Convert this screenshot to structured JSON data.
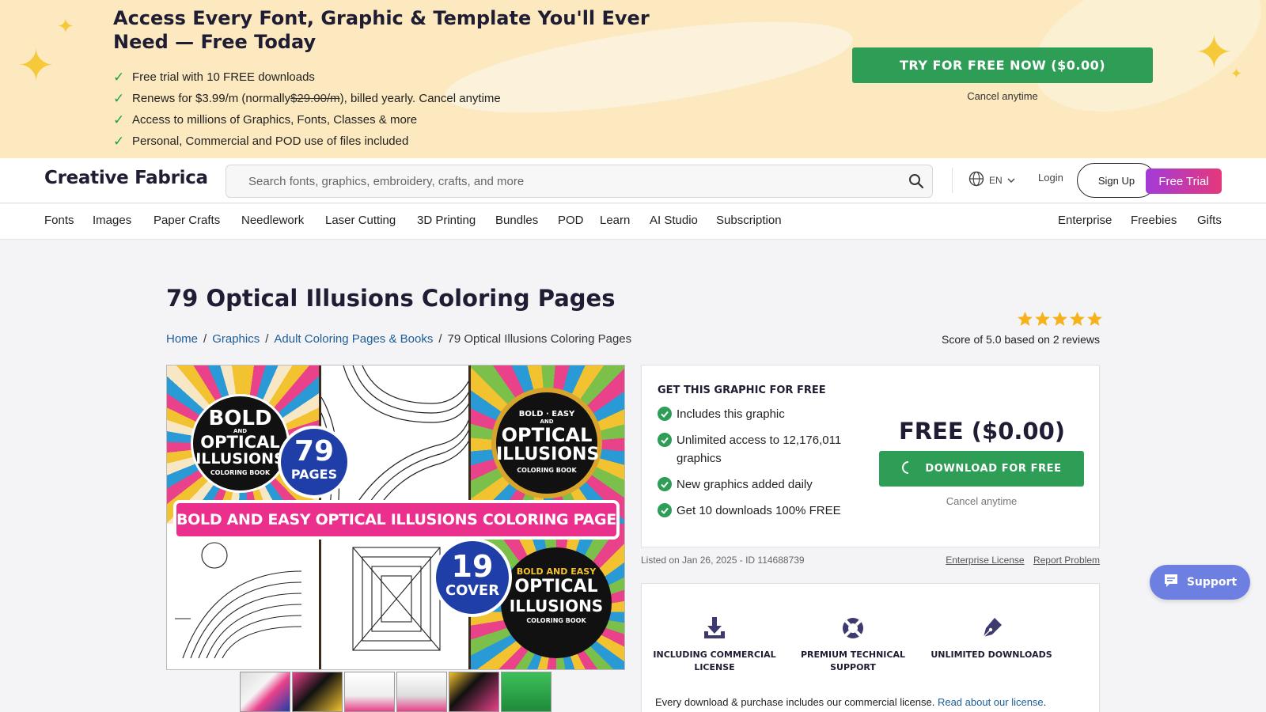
{
  "promo": {
    "headline": "Access Every Font, Graphic & Template You'll Ever Need — Free Today",
    "benefits": [
      "Free trial with 10 FREE downloads",
      "Access to millions of Graphics, Fonts, Classes & more",
      "Personal, Commercial and POD use of files included"
    ],
    "renews_prefix": "Renews for $3.99/m (normally ",
    "renews_strike": "$29.00/m",
    "renews_suffix": "), billed yearly. Cancel anytime",
    "cta_label": "TRY FOR FREE NOW ($0.00)",
    "cancel_text": "Cancel anytime"
  },
  "header": {
    "logo": "Creative Fabrica",
    "search_placeholder": "Search fonts, graphics, embroidery, crafts, and more",
    "language": "EN",
    "login": "Login",
    "signup": "Sign Up",
    "free_trial": "Free Trial"
  },
  "nav": {
    "left": [
      "Fonts",
      "Images",
      "Paper Crafts",
      "Needlework",
      "Laser Cutting",
      "3D Printing",
      "Bundles",
      "POD",
      "Learn",
      "AI Studio",
      "Subscription"
    ],
    "right": [
      "Enterprise",
      "Freebies",
      "Gifts"
    ]
  },
  "product": {
    "title": "79 Optical Illusions Coloring Pages",
    "breadcrumbs": [
      "Home",
      "Graphics",
      "Adult Coloring Pages & Books",
      "79 Optical Illusions Coloring Pages"
    ],
    "rating": {
      "stars": 5,
      "score_text": "Score of 5.0 based on 2 reviews"
    },
    "image": {
      "left_badge": [
        "BOLD",
        "AND",
        "OPTICAL",
        "ILLUSIONS",
        "COLORING BOOK"
      ],
      "pages_badge": [
        "79",
        "PAGES"
      ],
      "right_badge": [
        "BOLD",
        "EASY",
        "AND",
        "OPTICAL",
        "ILLUSIONS",
        "COLORING BOOK"
      ],
      "banner": "BOLD AND EASY OPTICAL ILLUSIONS COLORING PAGES",
      "cover_badge": [
        "19",
        "COVER"
      ],
      "corner_badge": [
        "BOLD",
        "AND",
        "EASY",
        "OPTICAL",
        "ILLUSIONS",
        "COLORING BOOK"
      ]
    },
    "thumbnails": 6
  },
  "offer": {
    "heading": "GET THIS GRAPHIC FOR FREE",
    "features": [
      "Includes this graphic",
      "Unlimited access to 12,176,011 graphics",
      "New graphics added daily",
      "Get 10 downloads 100% FREE"
    ],
    "price": "FREE ($0.00)",
    "download_label": "DOWNLOAD FOR FREE",
    "cancel_text": "Cancel anytime"
  },
  "meta": {
    "listed": "Listed on Jan 26, 2025 - ID 114688739",
    "enterprise_license": "Enterprise License",
    "report_problem": "Report Problem"
  },
  "benefits": {
    "items": [
      {
        "icon": "download-icon",
        "label": "INCLUDING COMMERCIAL LICENSE"
      },
      {
        "icon": "lifebuoy-icon",
        "label": "PREMIUM TECHNICAL SUPPORT"
      },
      {
        "icon": "pen-nib-icon",
        "label": "UNLIMITED DOWNLOADS"
      }
    ],
    "note_prefix": "Every download & purchase includes our commercial license. ",
    "note_link": "Read about our license",
    "note_suffix": "."
  },
  "support": {
    "label": "Support"
  },
  "colors": {
    "green": "#2e9e57",
    "navy": "#1f1d33",
    "link": "#1c5d99",
    "banner_bg": "#fde9bf",
    "star": "#f6b21a",
    "support": "#6d7fe0"
  }
}
